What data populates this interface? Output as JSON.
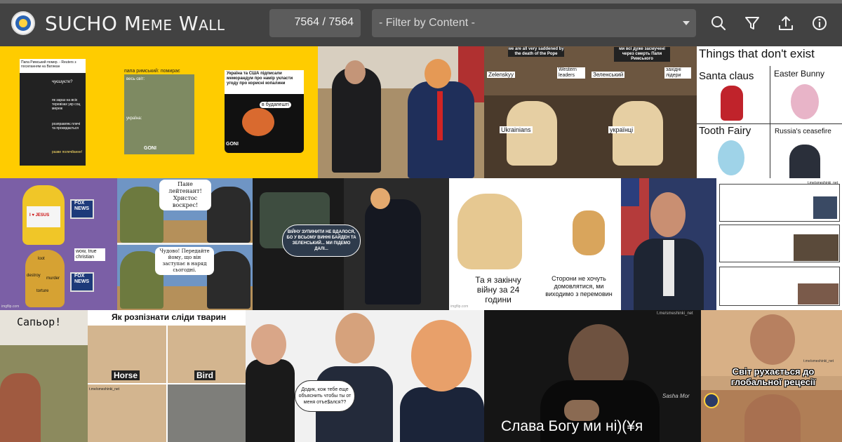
{
  "header": {
    "title": "SUCHO Meme Wall",
    "counter": "7564 / 7564",
    "filter_placeholder": "- Filter by Content -",
    "icons": [
      "search-icon",
      "filter-icon",
      "upload-icon",
      "info-icon"
    ]
  },
  "colors": {
    "topbar": "#424242",
    "control": "#5c5c5c",
    "accent_yellow": "#ffcc00"
  },
  "memes": {
    "m1": {
      "head1": "Папа Римський помер. - Reuters з посиланням на Ватикан",
      "r1": "чуєшуєте?",
      "r2": "як зараз на всіх теревізах укр соц мереж",
      "r3": "розправляє плечі та прокидається",
      "r4": "разве полечйанне!",
      "head2": "папа римський: помирає",
      "l1": "весь світ:",
      "l2": "україна:",
      "head3": "Україна та США підписали меморандум про намір укласти угоду про корисні копалини",
      "bubble": "в будапешті",
      "brand": "GONI"
    },
    "m3": {
      "top": "we are all very saddened by the death of the Pope",
      "l1": "Zelenskyy",
      "l2": "Western leaders",
      "dog": "Ukrainians"
    },
    "m4": {
      "top": "ми всі дуже засмучені через смерть Папи Римського",
      "l1": "Зеленський",
      "l2": "західні лідери",
      "dog": "українці"
    },
    "m5": {
      "title": "Things that don't exist",
      "a": "Santa claus",
      "b": "Easter Bunny",
      "c": "Tooth Fairy",
      "d": "Russia's ceasefire"
    },
    "m6": {
      "shirt": "I ♥ JESUS",
      "s1": "wow, true christian",
      "logo": "FOX NEWS",
      "b1": "loot",
      "b2": "destroy",
      "b3": "murder",
      "b4": "torture",
      "wm": "imgflip.com"
    },
    "m7": {
      "q": "Пане лейтенант! Христос воскрес!",
      "a": "Чудово! Передайте йому, що він заступає в наряд сьогодні."
    },
    "m8": {
      "bubble": "ВІЙНУ ЗУПИНИТИ НЕ ВДАЛОСЯ, БО У ВСЬОМУ ВИННІ БАЙДЕН ТА ЗЕЛЕНСЬКИЙ... МИ ПІДЕМО ДАЛІ..."
    },
    "m9": {
      "left": "Та я закінчу війну за 24 години",
      "right": "Сторони не хочуть домовлятися, ми виходимо з перемовин",
      "wm": "imgflip.com"
    },
    "m11": {
      "wm": "t.me/smeshinki_net"
    },
    "m12": {
      "title": "Сапьор!"
    },
    "m13": {
      "title": "Як розпізнати сліди тварин",
      "horse": "Horse",
      "bird": "Bird",
      "wm": "t.me/smeshinki_net"
    },
    "m14": {
      "bubble": "Додик, кож тебе еще объяснить чтобы ты от меня отъе$ался??"
    },
    "m15": {
      "caption": "Слава Богу ми ні)(¥я",
      "sign": "Sasha Mor",
      "wm": "t.me/smeshinki_net"
    },
    "m16": {
      "caption": "Світ рухається до глобальної рецесії",
      "wm": "t.me/smeshinki_net"
    }
  }
}
